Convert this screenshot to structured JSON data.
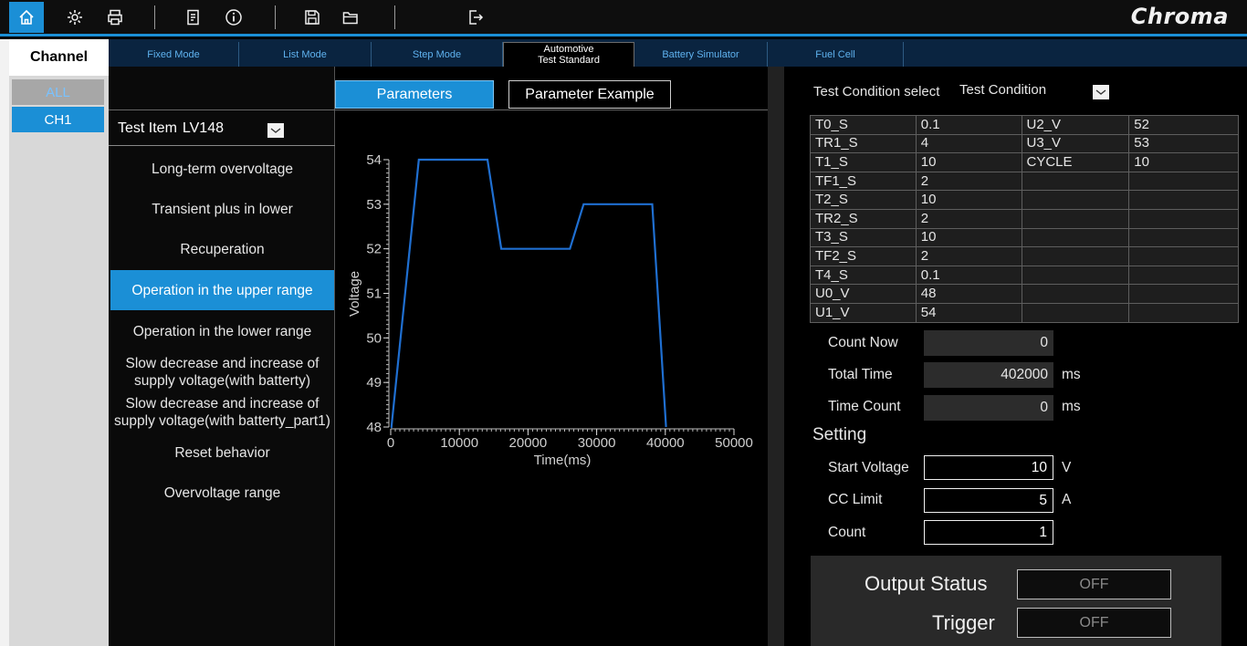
{
  "brand": "Chroma",
  "toolbar": {
    "icons": [
      "home-icon",
      "settings-icon",
      "printer-icon",
      "report-icon",
      "info-icon",
      "save-icon",
      "folder-open-icon",
      "exit-icon"
    ]
  },
  "channel": {
    "title": "Channel",
    "items": [
      "ALL",
      "CH1"
    ]
  },
  "mode_tabs": [
    "Fixed Mode",
    "List Mode",
    "Step Mode",
    "Automotive\nTest Standard",
    "Battery Simulator",
    "Fuel Cell"
  ],
  "param_tabs": {
    "parameters": "Parameters",
    "example": "Parameter Example"
  },
  "test_item": {
    "label": "Test Item",
    "value": "LV148"
  },
  "test_list": [
    "Long-term overvoltage",
    "Transient plus in lower",
    "Recuperation",
    "Operation in the upper range",
    "Operation in the lower range",
    "Slow decrease and increase of supply voltage(with batterty)",
    "Slow decrease and increase of supply voltage(with batterty_part1)",
    "Reset behavior",
    "Overvoltage range"
  ],
  "selected_test": "Operation in the upper range",
  "chart_data": {
    "type": "line",
    "xlabel": "Time(ms)",
    "ylabel": "Voltage",
    "xlim": [
      0,
      50000
    ],
    "ylim": [
      48,
      54
    ],
    "x_ticks": [
      0,
      10000,
      20000,
      30000,
      40000,
      50000
    ],
    "y_ticks": [
      48,
      49,
      50,
      51,
      52,
      53,
      54
    ],
    "series": [
      {
        "color": "#1f6fd1",
        "x": [
          0,
          100,
          4100,
          14100,
          16100,
          26100,
          28100,
          38100,
          40100
        ],
        "y": [
          48,
          48,
          54,
          54,
          52,
          52,
          53,
          53,
          48
        ]
      }
    ]
  },
  "test_condition": {
    "label": "Test Condition select",
    "value": "Test Condition"
  },
  "params": [
    [
      "T0_S",
      "0.1",
      "U2_V",
      "52"
    ],
    [
      "TR1_S",
      "4",
      "U3_V",
      "53"
    ],
    [
      "T1_S",
      "10",
      "CYCLE",
      "10"
    ],
    [
      "TF1_S",
      "2",
      "",
      ""
    ],
    [
      "T2_S",
      "10",
      "",
      ""
    ],
    [
      "TR2_S",
      "2",
      "",
      ""
    ],
    [
      "T3_S",
      "10",
      "",
      ""
    ],
    [
      "TF2_S",
      "2",
      "",
      ""
    ],
    [
      "T4_S",
      "0.1",
      "",
      ""
    ],
    [
      "U0_V",
      "48",
      "",
      ""
    ],
    [
      "U1_V",
      "54",
      "",
      ""
    ]
  ],
  "info": {
    "count_now_label": "Count Now",
    "count_now": "0",
    "total_time_label": "Total Time",
    "total_time": "402000",
    "total_time_unit": "ms",
    "time_count_label": "Time Count",
    "time_count": "0",
    "time_count_unit": "ms"
  },
  "setting": {
    "title": "Setting",
    "start_voltage_label": "Start Voltage",
    "start_voltage": "10",
    "start_voltage_unit": "V",
    "cc_limit_label": "CC Limit",
    "cc_limit": "5",
    "cc_limit_unit": "A",
    "count_label": "Count",
    "count": "1"
  },
  "output": {
    "status_label": "Output Status",
    "status_value": "OFF",
    "trigger_label": "Trigger",
    "trigger_value": "OFF"
  }
}
